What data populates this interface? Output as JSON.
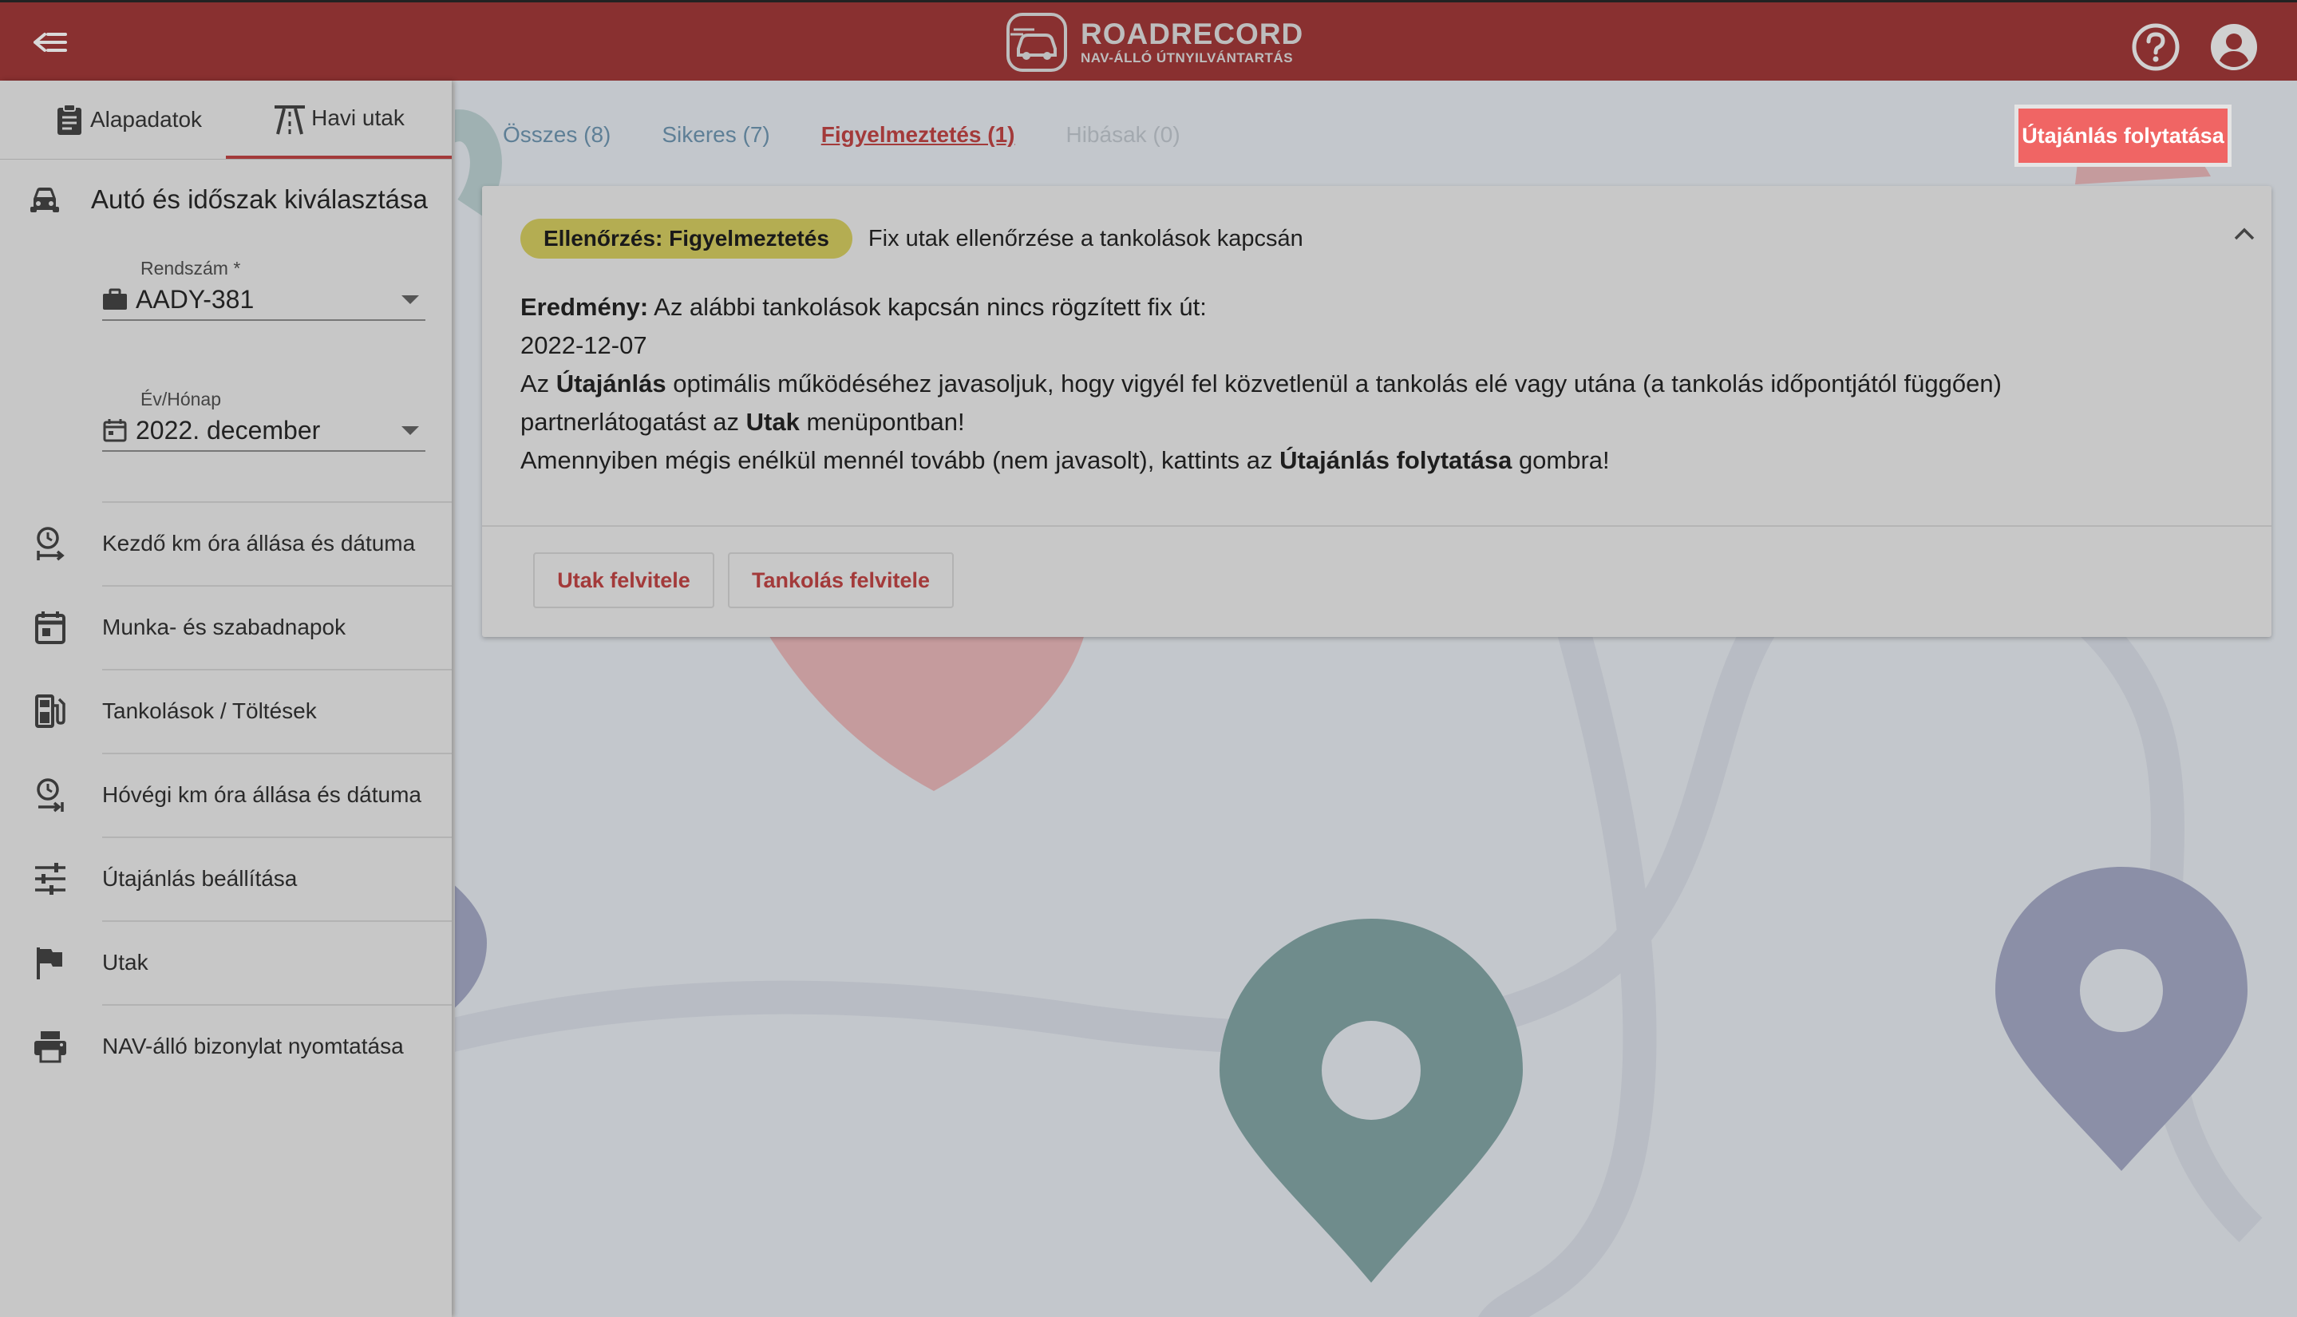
{
  "header": {
    "logo_title": "ROADRECORD",
    "logo_subtitle": "NAV-ÁLLÓ ÚTNYILVÁNTARTÁS",
    "back_icon": "back-arrow-icon",
    "help_icon": "help-circle-icon",
    "user_icon": "account-circle-icon"
  },
  "sidebar": {
    "tabs": [
      {
        "label": "Alapadatok",
        "icon": "clipboard-icon"
      },
      {
        "label": "Havi utak",
        "icon": "road-icon",
        "active": true
      }
    ],
    "section_title": "Autó és időszak kiválasztása",
    "plate": {
      "label": "Rendszám *",
      "value": "AADY-381"
    },
    "period": {
      "label": "Év/Hónap",
      "value": "2022. december"
    },
    "items": [
      {
        "label": "Kezdő km óra állása és dátuma",
        "icon": "clock-start-icon"
      },
      {
        "label": "Munka- és szabadnapok",
        "icon": "calendar-icon"
      },
      {
        "label": "Tankolások / Töltések",
        "icon": "fuel-pump-icon"
      },
      {
        "label": "Hóvégi km óra állása és dátuma",
        "icon": "clock-end-icon"
      },
      {
        "label": "Útajánlás beállítása",
        "icon": "sliders-icon"
      },
      {
        "label": "Utak",
        "icon": "flag-icon"
      },
      {
        "label": "NAV-álló bizonylat nyomtatása",
        "icon": "printer-icon"
      }
    ]
  },
  "filters": {
    "all": "Összes (8)",
    "success": "Sikeres (7)",
    "warning": "Figyelmeztetés (1)",
    "errors": "Hibásak (0)",
    "active": "warning"
  },
  "continue_button": "Útajánlás folytatása",
  "card": {
    "badge": "Ellenőrzés: Figyelmeztetés",
    "title": "Fix utak ellenőrzése a tankolások kapcsán",
    "result_label": "Eredmény:",
    "result_text": " Az alábbi tankolások kapcsán nincs rögzített fix út:",
    "date": "2022-12-07",
    "line3_a": "Az ",
    "line3_b": "Útajánlás",
    "line3_c": " optimális működéséhez javasoljuk, hogy vigyél fel közvetlenül a tankolás elé vagy utána (a tankolás időpontjától függően)",
    "line4_a": "partnerlátogatást az ",
    "line4_b": "Utak",
    "line4_c": " menüpontban!",
    "line5_a": "Amennyiben mégis enélkül mennél tovább (nem javasolt), kattints az ",
    "line5_b": "Útajánlás folytatása",
    "line5_c": " gombra!",
    "btn_trips": "Utak felvitele",
    "btn_fuel": "Tankolás felvitele"
  },
  "colors": {
    "header": "#893030",
    "accent": "#a33a3a",
    "continue_button": "#f06564",
    "warning_badge": "#b4ad52"
  }
}
